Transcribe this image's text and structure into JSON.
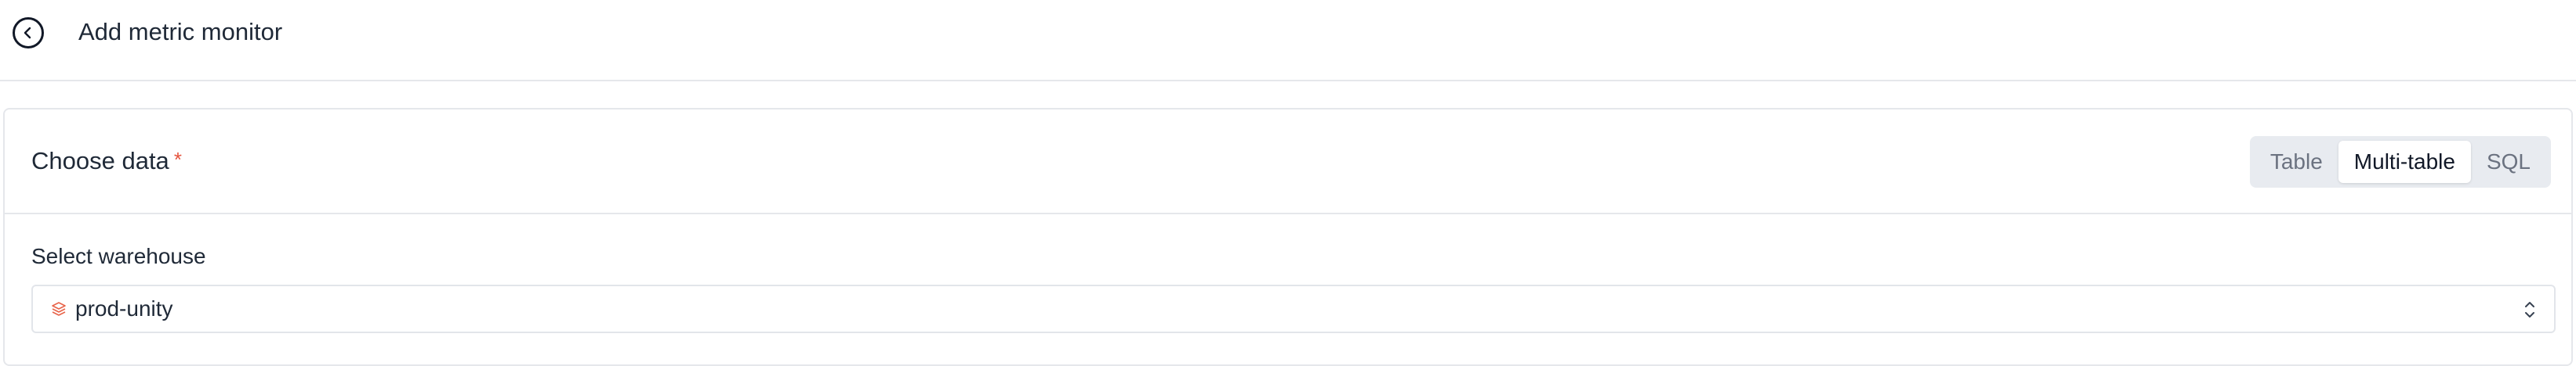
{
  "header": {
    "title": "Add metric monitor",
    "back_icon": "chevron-left-icon"
  },
  "choose_data": {
    "title": "Choose data",
    "required_mark": "*",
    "modes": [
      {
        "label": "Table",
        "active": false
      },
      {
        "label": "Multi-table",
        "active": true
      },
      {
        "label": "SQL",
        "active": false
      }
    ]
  },
  "warehouse": {
    "label": "Select warehouse",
    "value": "prod-unity",
    "icon": "stacked-layers-icon",
    "icon_color": "#e8644a",
    "indicator_icon": "chevron-up-down-icon"
  },
  "colors": {
    "accent_required": "#e5533d",
    "border": "#e5e7eb",
    "segment_bg": "#e8ebf0"
  }
}
